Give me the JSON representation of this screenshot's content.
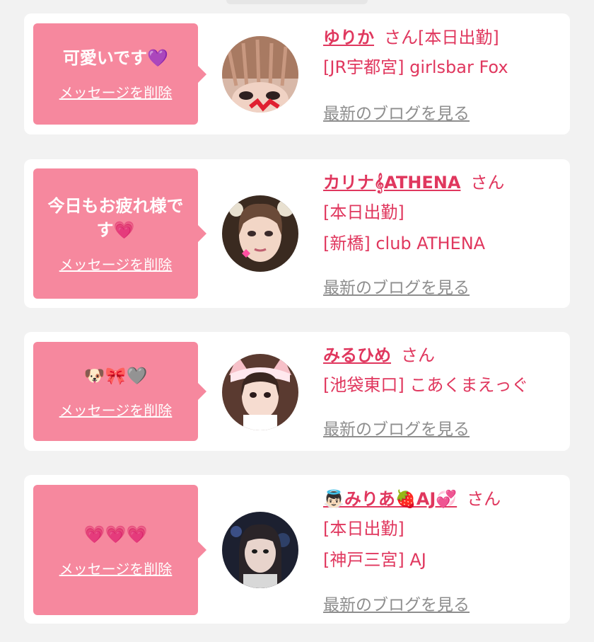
{
  "colors": {
    "accent": "#e0375e",
    "bubble": "#f6889e",
    "muted": "#8e8e8e",
    "background": "#f2f2f2"
  },
  "common": {
    "delete_label": "メッセージを削除",
    "blog_label": "最新のブログを見る",
    "san": "さん"
  },
  "cards": [
    {
      "message": "可愛いです💜",
      "name": "ゆりか",
      "lines": [
        "[JR宇都宮] girlsbar Fox"
      ],
      "name_suffix_inline": "[本日出勤]"
    },
    {
      "message": "今日もお疲れ様です💗",
      "name": "カリナ𝄞ATHENA",
      "lines": [
        "[本日出勤]",
        "[新橋] club ATHENA"
      ]
    },
    {
      "message": "🐶🎀🩶",
      "name": "みるひめ",
      "lines": [
        "[池袋東口] こあくまえっぐ"
      ]
    },
    {
      "message": "💗💗💗",
      "name": "👼🏻みりあ🍓AJ💞",
      "lines": [
        "[本日出勤]",
        "[神戸三宮] AJ"
      ]
    }
  ]
}
